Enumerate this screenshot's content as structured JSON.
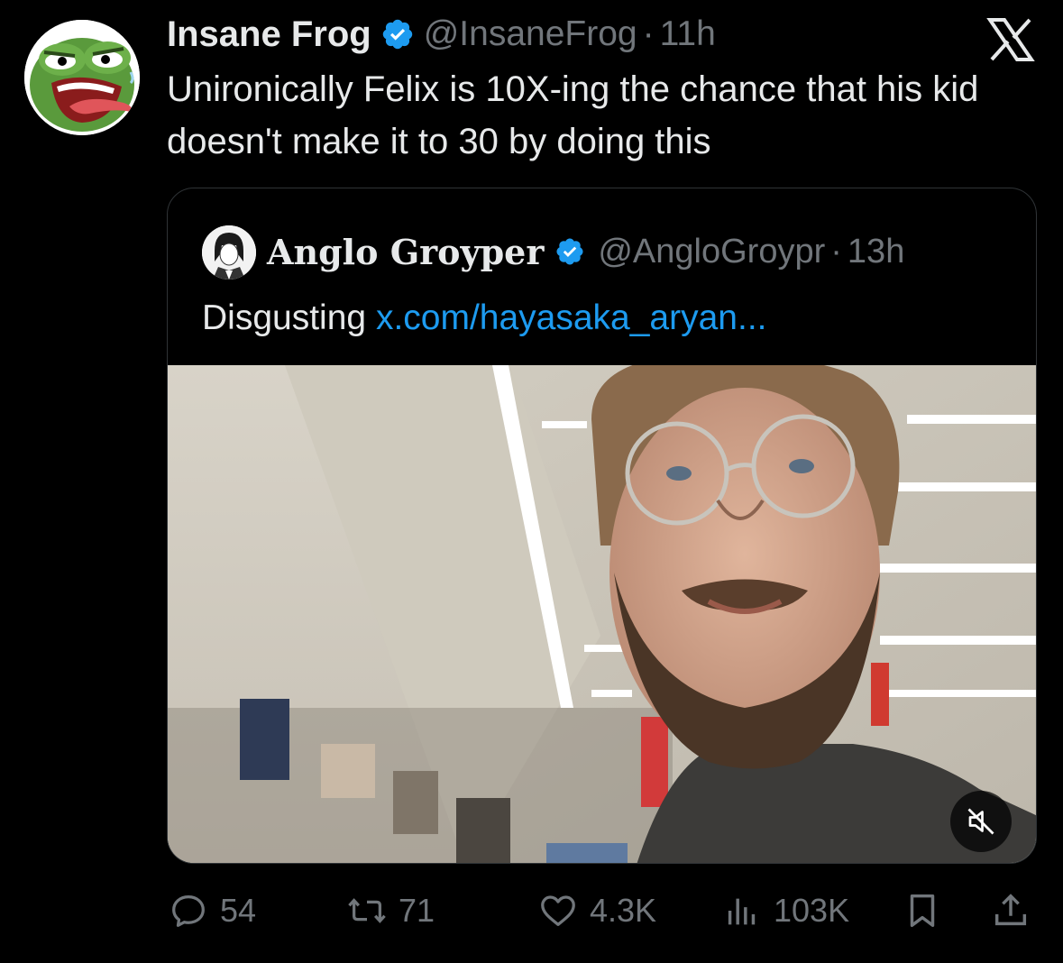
{
  "tweet": {
    "author_name": "Insane Frog",
    "handle": "@InsaneFrog",
    "separator": "·",
    "time": "11h",
    "text": "Unironically Felix is 10X-ing the chance that his kid doesn't make it to 30 by doing this",
    "avatar_icon": "pepe-frog-avatar",
    "brand_icon": "x-logo-icon"
  },
  "quote": {
    "author_name": "Anglo Groyper",
    "handle": "@AngloGroypr",
    "separator": "·",
    "time": "13h",
    "text": "Disgusting",
    "link_text": "x.com/hayasaka_aryan...",
    "media": {
      "type": "video",
      "muted": true,
      "mute_icon": "speaker-muted-icon"
    }
  },
  "actions": {
    "replies": "54",
    "reposts": "71",
    "likes": "4.3K",
    "views": "103K"
  },
  "colors": {
    "background": "#000000",
    "text": "#e7e9ea",
    "secondary": "#71767b",
    "link": "#1d9bf0",
    "verified": "#1d9bf0",
    "border": "#2f3336"
  }
}
